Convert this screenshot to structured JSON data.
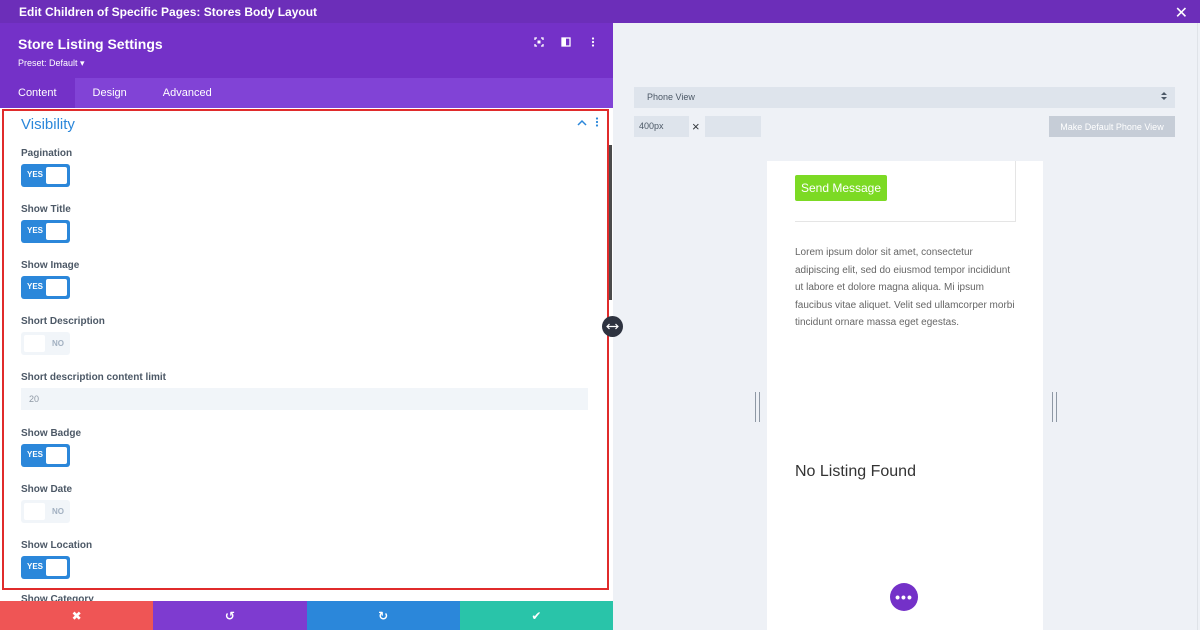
{
  "window": {
    "title": "Edit Children of Specific Pages: Stores Body Layout",
    "close": "✕"
  },
  "panel": {
    "title": "Store Listing Settings",
    "preset": "Preset: Default ▾",
    "icons": [
      "focus-icon",
      "split-view-icon",
      "more-options-icon"
    ],
    "tabs": [
      {
        "label": "Content",
        "active": true
      },
      {
        "label": "Design",
        "active": false
      },
      {
        "label": "Advanced",
        "active": false
      }
    ],
    "section": {
      "title": "Visibility",
      "fields": [
        {
          "label": "Pagination",
          "type": "toggle",
          "state": "YES"
        },
        {
          "label": "Show Title",
          "type": "toggle",
          "state": "YES"
        },
        {
          "label": "Show Image",
          "type": "toggle",
          "state": "YES"
        },
        {
          "label": "Short Description",
          "type": "toggle",
          "state": "NO"
        },
        {
          "label": "Short description content limit",
          "type": "number",
          "value": "20"
        },
        {
          "label": "Show Badge",
          "type": "toggle",
          "state": "YES"
        },
        {
          "label": "Show Date",
          "type": "toggle",
          "state": "NO"
        },
        {
          "label": "Show Location",
          "type": "toggle",
          "state": "YES"
        }
      ],
      "peek_label": "Show Category"
    },
    "footer": {
      "cancel": "✖",
      "undo": "↺",
      "redo": "↻",
      "save": "✔"
    }
  },
  "preview": {
    "view_select": "Phone View",
    "width_value": "400px",
    "clear_icon": "×",
    "make_default": "Make Default Phone View",
    "send_button": "Send Message",
    "lorem": "Lorem ipsum dolor sit amet, consectetur adipiscing elit, sed do eiusmod tempor incididunt ut labore et dolore magna aliqua. Mi ipsum faucibus vitae aliquet. Velit sed ullamcorper morbi tincidunt ornare massa eget egestas.",
    "no_listing": "No Listing Found",
    "dots": "•••"
  },
  "colors": {
    "brand_purple": "#7431c8",
    "accent_blue": "#2b87da",
    "cancel_red": "#ef5555",
    "save_teal": "#29c4a9",
    "highlight_red": "#e02b2b",
    "send_green": "#7cda24"
  }
}
